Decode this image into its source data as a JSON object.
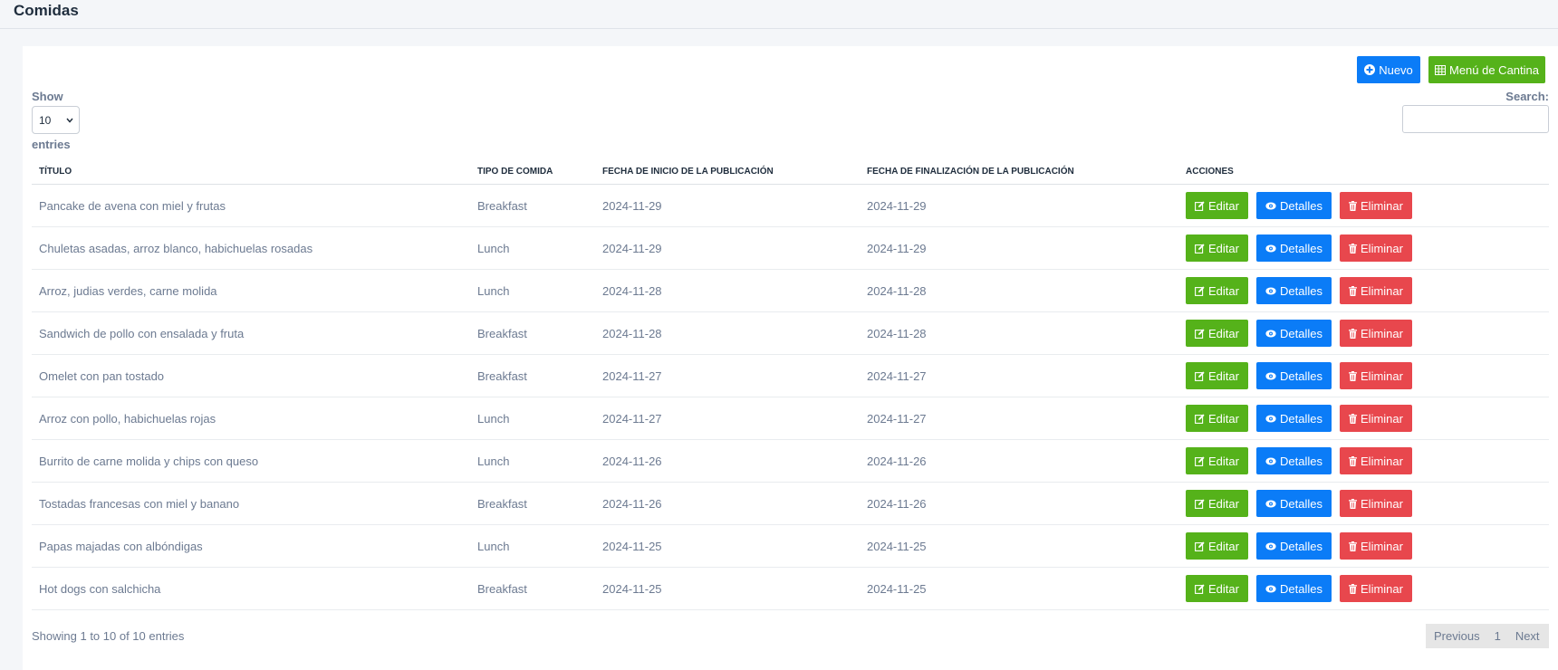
{
  "page": {
    "title": "Comidas"
  },
  "toolbar": {
    "new_label": "Nuevo",
    "menu_label": "Menú de Cantina"
  },
  "length": {
    "show_label": "Show",
    "value": "10",
    "entries_label": "entries"
  },
  "search": {
    "label": "Search:",
    "value": ""
  },
  "table": {
    "columns": [
      "TÍTULO",
      "TIPO DE COMIDA",
      "FECHA DE INICIO DE LA PUBLICACIÓN",
      "FECHA DE FINALIZACIÓN DE LA PUBLICACIÓN",
      "ACCIONES"
    ],
    "actions": {
      "edit": "Editar",
      "details": "Detalles",
      "delete": "Eliminar"
    },
    "rows": [
      {
        "title": "Pancake de avena con miel y frutas",
        "type": "Breakfast",
        "start": "2024-11-29",
        "end": "2024-11-29"
      },
      {
        "title": "Chuletas asadas, arroz blanco, habichuelas rosadas",
        "type": "Lunch",
        "start": "2024-11-29",
        "end": "2024-11-29"
      },
      {
        "title": "Arroz, judias verdes, carne molida",
        "type": "Lunch",
        "start": "2024-11-28",
        "end": "2024-11-28"
      },
      {
        "title": "Sandwich de pollo con ensalada y fruta",
        "type": "Breakfast",
        "start": "2024-11-28",
        "end": "2024-11-28"
      },
      {
        "title": "Omelet con pan tostado",
        "type": "Breakfast",
        "start": "2024-11-27",
        "end": "2024-11-27"
      },
      {
        "title": "Arroz con pollo, habichuelas rojas",
        "type": "Lunch",
        "start": "2024-11-27",
        "end": "2024-11-27"
      },
      {
        "title": "Burrito de carne molida y chips con queso",
        "type": "Lunch",
        "start": "2024-11-26",
        "end": "2024-11-26"
      },
      {
        "title": "Tostadas francesas con miel y banano",
        "type": "Breakfast",
        "start": "2024-11-26",
        "end": "2024-11-26"
      },
      {
        "title": "Papas majadas con albóndigas",
        "type": "Lunch",
        "start": "2024-11-25",
        "end": "2024-11-25"
      },
      {
        "title": "Hot dogs con salchicha",
        "type": "Breakfast",
        "start": "2024-11-25",
        "end": "2024-11-25"
      }
    ]
  },
  "footer": {
    "info": "Showing 1 to 10 of 10 entries",
    "previous": "Previous",
    "page": "1",
    "next": "Next"
  },
  "icons": {
    "new": "plus-circle-icon",
    "menu": "table-icon",
    "edit": "edit-icon",
    "details": "eye-icon",
    "delete": "trash-icon",
    "select": "chevron-down-icon"
  },
  "colors": {
    "primary": "#0b7cf7",
    "success": "#55b21a",
    "danger": "#e8474d"
  }
}
